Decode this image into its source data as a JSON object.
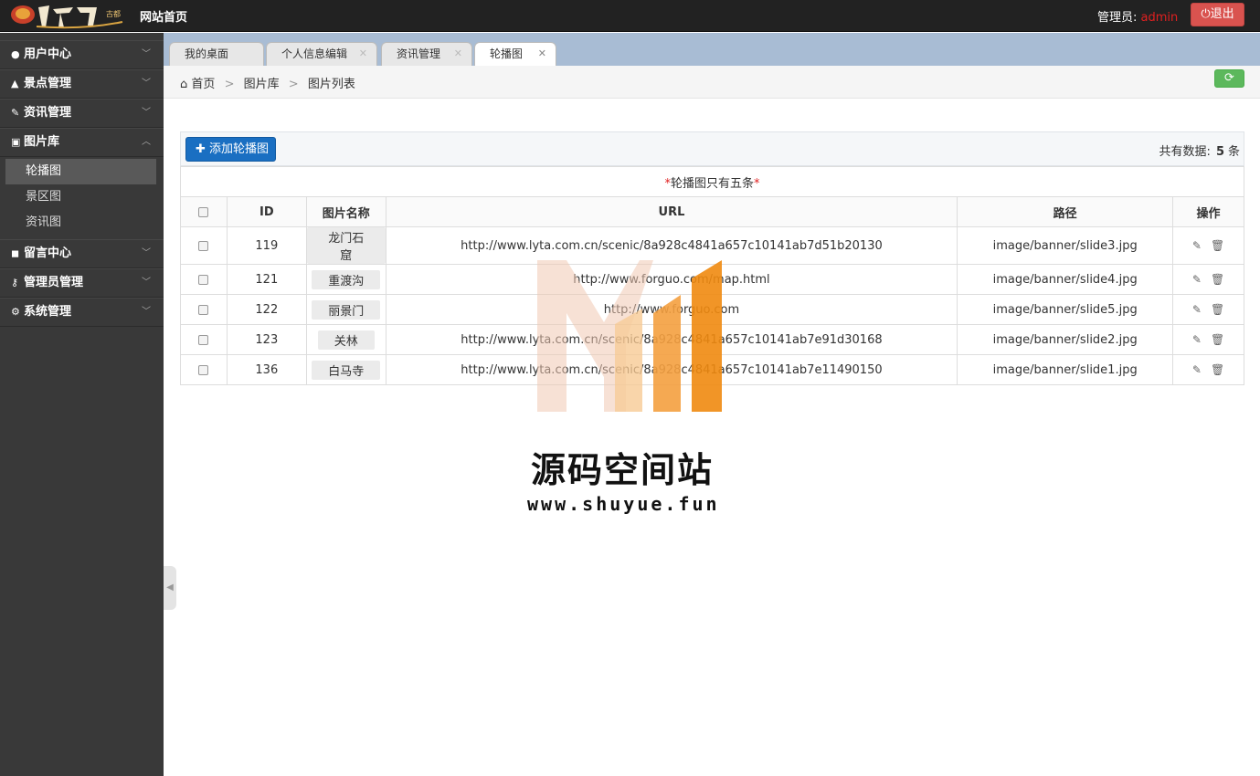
{
  "header": {
    "site_title": "网站首页",
    "admin_label": "管理员:",
    "admin_name": "admin",
    "logout": "退出"
  },
  "sidebar": {
    "menus": [
      {
        "icon": "user-icon",
        "label": "用户中心"
      },
      {
        "icon": "flask-icon",
        "label": "景点管理"
      },
      {
        "icon": "edit-icon",
        "label": "资讯管理"
      },
      {
        "icon": "picture-icon",
        "label": "图片库",
        "expanded": true,
        "children": [
          {
            "label": "轮播图",
            "active": true
          },
          {
            "label": "景区图"
          },
          {
            "label": "资讯图"
          }
        ]
      },
      {
        "icon": "comments-icon",
        "label": "留言中心"
      },
      {
        "icon": "key-icon",
        "label": "管理员管理"
      },
      {
        "icon": "cogs-icon",
        "label": "系统管理"
      }
    ]
  },
  "tabs": [
    {
      "label": "我的桌面"
    },
    {
      "label": "个人信息编辑"
    },
    {
      "label": "资讯管理"
    },
    {
      "label": "轮播图",
      "active": true
    }
  ],
  "breadcrumb": {
    "home": "首页",
    "level1": "图片库",
    "level2": "图片列表"
  },
  "toolbar": {
    "add_label": "添加轮播图",
    "total_prefix": "共有数据:",
    "total_count": "5",
    "total_suffix": "条"
  },
  "table": {
    "notice": "轮播图只有五条",
    "columns": [
      "ID",
      "图片名称",
      "URL",
      "路径",
      "操作"
    ],
    "rows": [
      {
        "id": "119",
        "name": "龙门石窟",
        "url": "http://www.lyta.com.cn/scenic/8a928c4841a657c10141ab7d51b20130",
        "path": "image/banner/slide3.jpg"
      },
      {
        "id": "121",
        "name": "重渡沟",
        "url": "http://www.forguo.com/map.html",
        "path": "image/banner/slide4.jpg"
      },
      {
        "id": "122",
        "name": "丽景门",
        "url": "http://www.forguo.com",
        "path": "image/banner/slide5.jpg"
      },
      {
        "id": "123",
        "name": "关林",
        "url": "http://www.lyta.com.cn/scenic/8a928c4841a657c10141ab7e91d30168",
        "path": "image/banner/slide2.jpg"
      },
      {
        "id": "136",
        "name": "白马寺",
        "url": "http://www.lyta.com.cn/scenic/8a928c4841a657c10141ab7e11490150",
        "path": "image/banner/slide1.jpg"
      }
    ]
  },
  "watermark": {
    "title": "源码空间站",
    "url": "www.shuyue.fun"
  },
  "colors": {
    "sidebar_bg": "#393939",
    "topbar_bg": "#222222",
    "logout_bg": "#d9534f",
    "add_btn_bg": "#1a6fc2",
    "refresh_bg": "#5cb85c",
    "admin_name": "#e02020"
  }
}
